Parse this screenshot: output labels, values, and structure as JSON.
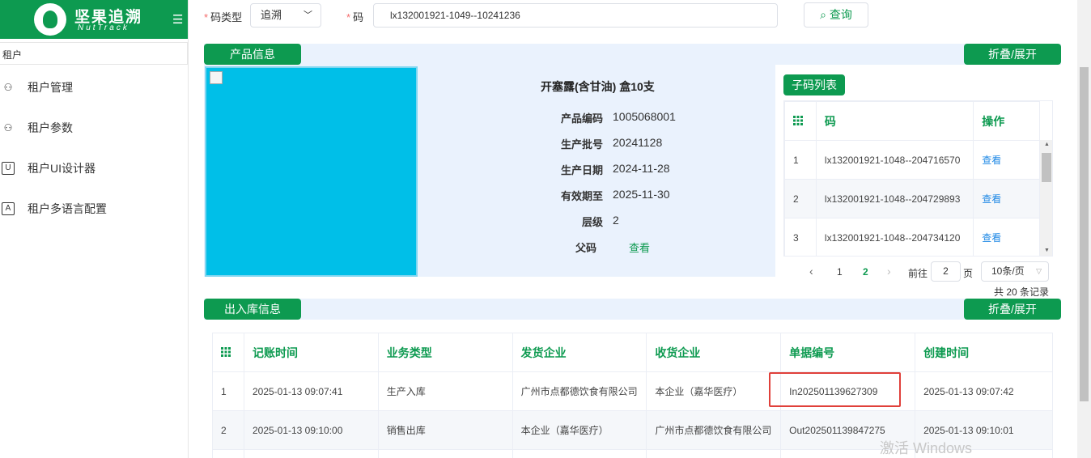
{
  "logo": {
    "name": "坚果追溯",
    "sub": "NutTrack"
  },
  "breadcrumb": "租户",
  "sidebar": {
    "items": [
      {
        "label": "租户管理",
        "icon": "user-gear-icon"
      },
      {
        "label": "租户参数",
        "icon": "user-gear-icon"
      },
      {
        "label": "租户UI设计器",
        "icon": "ui-box-icon"
      },
      {
        "label": "租户多语言配置",
        "icon": "language-icon"
      }
    ]
  },
  "query": {
    "code_type_label": "码类型",
    "code_type_value": "追溯",
    "code_label": "码",
    "code_value": "lx132001921-1049--10241236",
    "search_label": "查询"
  },
  "product": {
    "tab": "产品信息",
    "toggle": "折叠/展开",
    "name": "开塞露(含甘油) 盒10支",
    "fields": [
      {
        "k": "产品编码",
        "v": "1005068001"
      },
      {
        "k": "生产批号",
        "v": "20241128"
      },
      {
        "k": "生产日期",
        "v": "2024-11-28"
      },
      {
        "k": "有效期至",
        "v": "2025-11-30"
      },
      {
        "k": "层级",
        "v": "2"
      }
    ],
    "parent_label": "父码",
    "parent_link": "查看"
  },
  "subcodes": {
    "title": "子码列表",
    "headers": {
      "code": "码",
      "action": "操作"
    },
    "rows": [
      {
        "idx": "1",
        "code": "lx132001921-1048--204716570",
        "action": "查看"
      },
      {
        "idx": "2",
        "code": "lx132001921-1048--204729893",
        "action": "查看"
      },
      {
        "idx": "3",
        "code": "lx132001921-1048--204734120",
        "action": "查看"
      }
    ],
    "pager": {
      "pages": [
        "1",
        "2"
      ],
      "current": "2",
      "goto_label": "前往",
      "goto_value": "2",
      "page_unit": "页",
      "size": "10条/页",
      "total": "共 20 条记录"
    }
  },
  "inout": {
    "tab": "出入库信息",
    "toggle": "折叠/展开",
    "headers": [
      "记账时间",
      "业务类型",
      "发货企业",
      "收货企业",
      "单据编号",
      "创建时间"
    ],
    "rows": [
      {
        "idx": "1",
        "time": "2025-01-13 09:07:41",
        "type": "生产入库",
        "from": "广州市点都德饮食有限公司",
        "to": "本企业（嘉华医疗）",
        "doc": "In202501139627309",
        "created": "2025-01-13 09:07:42"
      },
      {
        "idx": "2",
        "time": "2025-01-13 09:10:00",
        "type": "销售出库",
        "from": "本企业（嘉华医疗）",
        "to": "广州市点都德饮食有限公司",
        "doc": "Out202501139847275",
        "created": "2025-01-13 09:10:01"
      }
    ]
  },
  "watermark": "激活 Windows",
  "colors": {
    "brand": "#0d9a50",
    "image_placeholder": "#00bfe8",
    "band": "#eaf2fd",
    "highlight": "#e0403a",
    "link": "#1e88e5"
  }
}
